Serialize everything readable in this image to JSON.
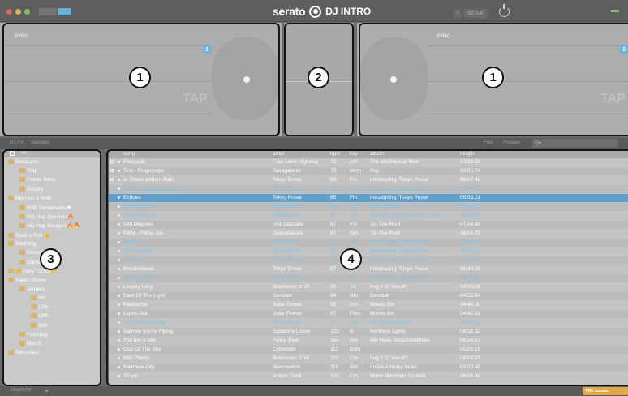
{
  "app": {
    "brand": "serato",
    "product": "DJ INTRO",
    "help_label": "?",
    "setup_label": "SETUP",
    "accent": "#6fb3dc",
    "highlight": "#e2a94a"
  },
  "decks": {
    "left": {
      "sync": "SYNC",
      "number": "1",
      "tap": "TAP"
    },
    "right": {
      "sync": "SYNC",
      "number": "2",
      "tap": "TAP"
    }
  },
  "callouts": [
    "1",
    "2",
    "1",
    "3",
    "4"
  ],
  "library_bar": {
    "tab_djfx": "DJ-FX",
    "tab_samples": "Samples",
    "files": "Files",
    "prepare": "Prepare",
    "search_placeholder": "Q▾"
  },
  "crates": {
    "header": "All",
    "items": [
      {
        "label": "Electronic",
        "indent": 0
      },
      {
        "label": "Trap",
        "indent": 1
      },
      {
        "label": "Future Bass",
        "indent": 1
      },
      {
        "label": "Electro",
        "indent": 1
      },
      {
        "label": "Hip Hop & RnB",
        "indent": 0
      },
      {
        "label": "RnB Throwbacks❤",
        "indent": 1
      },
      {
        "label": "Hip Hop Openers🔥",
        "indent": 1
      },
      {
        "label": "Hip Hop Bangers🔥🔥",
        "indent": 1
      },
      {
        "label": "Rock n Roll 🤘",
        "indent": 0
      },
      {
        "label": "Wedding",
        "indent": 0
      },
      {
        "label": "Dinner",
        "indent": 1
      },
      {
        "label": "Dancefloor🕺",
        "indent": 1
      },
      {
        "label": "🙌Party Tunes🙌",
        "indent": 0
      },
      {
        "label": "Radio Shows",
        "indent": 0
      },
      {
        "label": "January",
        "indent": 1
      },
      {
        "label": "5th",
        "indent": 2
      },
      {
        "label": "12th",
        "indent": 2
      },
      {
        "label": "19th",
        "indent": 2
      },
      {
        "label": "26th",
        "indent": 2
      },
      {
        "label": "February",
        "indent": 1
      },
      {
        "label": "March",
        "indent": 1
      },
      {
        "label": "Recorded",
        "indent": 0
      }
    ]
  },
  "tracklist": {
    "columns": {
      "song": "song",
      "artist": "artist",
      "bpm": "bpm",
      "key": "key",
      "album": "album",
      "length": "length"
    },
    "rows": [
      {
        "song": "Pussycat",
        "artist": "Four Lane Highway",
        "bpm": "73",
        "key": "Am",
        "album": "The Mechanical Man",
        "length": "03:59.28",
        "style": "normal"
      },
      {
        "song": "Test - Fingerpops",
        "artist": "Garageland",
        "bpm": "75",
        "key": "G#m",
        "album": "Pop",
        "length": "02:50.74",
        "style": "normal"
      },
      {
        "song": "A - Rose without Rain",
        "artist": "Tokyo Prose",
        "bpm": "85",
        "key": "Fm",
        "album": "Introducing: Tokyo Prose",
        "length": "06:07.46",
        "style": "normal"
      },
      {
        "song": "Eastern Highway Remix",
        "artist": "Tokyo Prose",
        "bpm": "85",
        "key": "Cm",
        "album": "Introducing: Tokyo Prose",
        "length": "06:44.53",
        "style": "blue"
      },
      {
        "song": "Echoes",
        "artist": "Tokyo Prose",
        "bpm": "85",
        "key": "Fm",
        "album": "Introducing: Tokyo Prose",
        "length": "05:05.01",
        "style": "selected"
      },
      {
        "song": "Evening Dark",
        "artist": "Bobabacker",
        "bpm": "87",
        "key": "Cm",
        "album": "Downsetting",
        "length": "06:42.91",
        "style": "blue"
      },
      {
        "song": "Bring me Back",
        "artist": "Bobabacker",
        "bpm": "87",
        "key": "Am",
        "album": "Everything Else Known to man",
        "length": "06:56.08",
        "style": "blue"
      },
      {
        "song": "500 Degrees",
        "artist": "Grenadesafe",
        "bpm": "87",
        "key": "Fm",
        "album": "Tip The Roof",
        "length": "07:04.80",
        "style": "normal"
      },
      {
        "song": "Filthy - Filthy Joe",
        "artist": "Grenadesafe",
        "bpm": "87",
        "key": "Gm",
        "album": "Tip The Roof",
        "length": "06:00.75",
        "style": "normal"
      },
      {
        "song": "Royale",
        "artist": "The Guilty",
        "bpm": "87",
        "key": "Gm",
        "album": "Introducing: Tokyo Prose",
        "length": "05:21.44",
        "style": "blue"
      },
      {
        "song": "All You Want",
        "artist": "Tokyo Prose",
        "bpm": "87",
        "key": "Cm",
        "album": "Introducing: Tokyo Prose",
        "length": "07:24.21",
        "style": "blue"
      },
      {
        "song": "Apogee",
        "artist": "Tokyo Prose",
        "bpm": "87",
        "key": "Gm",
        "album": "Introducing: Tokyo Prose",
        "length": "06:04.20",
        "style": "blue"
      },
      {
        "song": "Knucklehead",
        "artist": "Tokyo Prose",
        "bpm": "87",
        "key": "Gm",
        "album": "Introducing: Tokyo Prose",
        "length": "05:40.06",
        "style": "normal"
      },
      {
        "song": "Saving Grace",
        "artist": "Tokyo Prose",
        "bpm": "87",
        "key": "Em",
        "album": "Introducing: Tokyo Prose",
        "length": "06:01.48",
        "style": "blue"
      },
      {
        "song": "Loosey Lucy",
        "artist": "Brain over a hill",
        "bpm": "89",
        "key": "7A",
        "album": "hug it Or kiss it?",
        "length": "04:13.28",
        "style": "normal"
      },
      {
        "song": "Dark Of The Light",
        "artist": "Comball",
        "bpm": "94",
        "key": "Dm",
        "album": "Comball",
        "length": "04:53.64",
        "style": "normal"
      },
      {
        "song": "Redeemer",
        "artist": "Solar Flower",
        "bpm": "95",
        "key": "Am",
        "album": "Moves On",
        "length": "04:44.00",
        "style": "normal"
      },
      {
        "song": "Lights Out",
        "artist": "Solar Flower",
        "bpm": "97",
        "key": "F#m",
        "album": "Moves On",
        "length": "04:42.93",
        "style": "normal"
      },
      {
        "song": "This Is Not forever",
        "artist": "Trade Slater",
        "bpm": "97",
        "key": "Am",
        "album": "My Only Salvation",
        "length": "02:59.10",
        "style": "blue"
      },
      {
        "song": "Batman you're Flying",
        "artist": "Suddenly Loose",
        "bpm": "103",
        "key": "B",
        "album": "Northern Lights",
        "length": "04:18.32",
        "style": "normal"
      },
      {
        "song": "You are a star",
        "artist": "Flying Blue",
        "bpm": "104",
        "key": "Am",
        "album": "We Have Responsibilities",
        "length": "05:24.02",
        "style": "normal"
      },
      {
        "song": "God Of The Sky",
        "artist": "Cyberskin",
        "bpm": "110",
        "key": "Bbm",
        "album": "",
        "length": "05:03.16",
        "style": "normal"
      },
      {
        "song": "Wet Plastic",
        "artist": "Brain over a hill",
        "bpm": "111",
        "key": "Cm",
        "album": "hug it Or kiss it?",
        "length": "04:03.20",
        "style": "normal"
      },
      {
        "song": "Rainbow City",
        "artist": "Massivelsm",
        "bpm": "119",
        "key": "Bm",
        "album": "Inside A Noisy Brain",
        "length": "03:39.48",
        "style": "normal"
      },
      {
        "song": "10 pm",
        "artist": "Action Track",
        "bpm": "120",
        "key": "Cm",
        "album": "Moon Mountain Sounds",
        "length": "06:08.46",
        "style": "normal"
      }
    ]
  },
  "bottom": {
    "album_art": "Album Art",
    "add_label": "+",
    "try_label": "TRY serato"
  }
}
